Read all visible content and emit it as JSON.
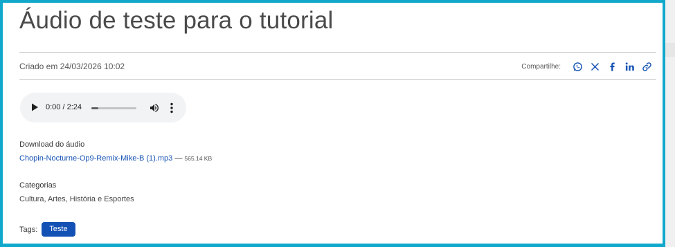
{
  "article": {
    "title": "Áudio de teste para o tutorial",
    "created": "Criado em 24/03/2026 10:02"
  },
  "share": {
    "label": "Compartilhe:",
    "icons": [
      "whatsapp-icon",
      "x-icon",
      "facebook-icon",
      "linkedin-icon",
      "link-icon"
    ],
    "icon_color": "#1351b4"
  },
  "player": {
    "time": "0:00 / 2:24",
    "progress": 0.0
  },
  "download": {
    "heading": "Download do áudio",
    "filename": "Chopin-Nocturne-Op9-Remix-Mike-B (1).mp3",
    "separator": " — ",
    "size": "565.14 KB"
  },
  "categories": {
    "heading": "Categorias",
    "value": "Cultura, Artes, História e Esportes"
  },
  "tags": {
    "label": "Tags:",
    "items": [
      "Teste"
    ]
  },
  "colors": {
    "frame": "#11a8cc",
    "accent": "#1351b4"
  }
}
